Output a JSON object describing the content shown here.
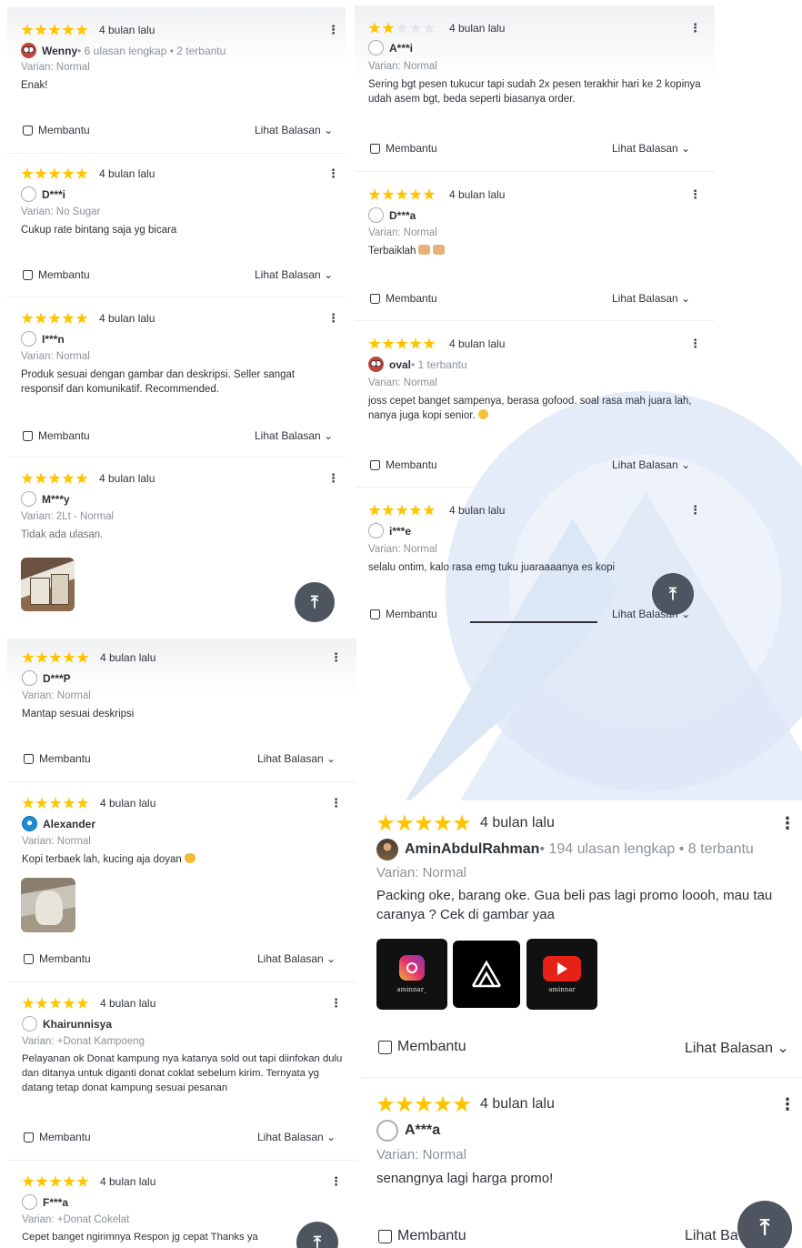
{
  "common": {
    "time_ago": "4 bulan lalu",
    "helpful_label": "Membantu",
    "reply_label": "Lihat Balasan",
    "kebab": "⋮",
    "scroll_top": "⤒",
    "chevron": "⌄",
    "star_color": "#ffc400",
    "star_empty_color": "#e4e6e9"
  },
  "panel_a": {
    "reviews": [
      {
        "rating": 5,
        "user": "Wenny",
        "meta": " • 6 ulasan lengkap • 2 terbantu",
        "variant": "Varian: Normal",
        "text": "Enak!"
      },
      {
        "rating": 5,
        "user": "D***i",
        "meta": "",
        "variant": "Varian: No Sugar",
        "text": "Cukup rate bintang saja yg bicara"
      },
      {
        "rating": 5,
        "user": "I***n",
        "meta": "",
        "variant": "Varian: Normal",
        "text": "Produk sesuai dengan gambar dan deskripsi. Seller sangat responsif dan komunikatif. Recommended."
      },
      {
        "rating": 5,
        "user": "M***y",
        "meta": "",
        "variant": "Varian: 2Lt - Normal",
        "text": "Tidak ada ulasan."
      }
    ]
  },
  "panel_b": {
    "reviews": [
      {
        "rating": 2,
        "user": "A***i",
        "meta": "",
        "variant": "Varian: Normal",
        "text": "Sering bgt pesen tukucur tapi sudah 2x pesen terakhir hari ke 2 kopinya udah asem bgt, beda seperti biasanya order."
      },
      {
        "rating": 5,
        "user": "D***a",
        "meta": "",
        "variant": "Varian: Normal",
        "text": "Terbaiklah"
      },
      {
        "rating": 5,
        "user": "oval",
        "meta": " • 1 terbantu",
        "variant": "Varian: Normal",
        "text": "joss cepet banget sampenya, berasa gofood. soal rasa mah juara lah, nanya juga kopi senior."
      },
      {
        "rating": 5,
        "user": "i***e",
        "meta": "",
        "variant": "Varian: Normal",
        "text": "selalu ontim, kalo rasa emg tuku juaraaaanya es kopi"
      }
    ]
  },
  "panel_c": {
    "reviews": [
      {
        "rating": 5,
        "user": "D***P",
        "meta": "",
        "variant": "Varian: Normal",
        "text": "Mantap sesuai deskripsi"
      },
      {
        "rating": 5,
        "user": "Alexander",
        "meta": "",
        "variant": "Varian: Normal",
        "text": "Kopi terbaek lah, kucing aja doyan"
      },
      {
        "rating": 5,
        "user": "Khairunnisya",
        "meta": "",
        "variant": "Varian: +Donat Kampoeng",
        "text": "Pelayanan ok Donat kampung nya katanya sold out tapi diinfokan dulu dan ditanya untuk diganti donat coklat sebelum kirim. Ternyata yg datang tetap donat kampung sesuai pesanan"
      },
      {
        "rating": 5,
        "user": "F***a",
        "meta": "",
        "variant": "Varian: +Donat Cokelat",
        "text": "Cepet banget ngirimnya Respon jg cepat Thanks ya"
      }
    ]
  },
  "panel_d": {
    "reviews": [
      {
        "rating": 5,
        "user": "AminAbdulRahman",
        "meta": " • 194 ulasan lengkap • 8 terbantu",
        "variant": "Varian: Normal",
        "text": "Packing oke, barang oke. Gua beli pas lagi promo loooh, mau tau caranya ? Cek di gambar yaa"
      },
      {
        "rating": 5,
        "user": "A***a",
        "meta": "",
        "variant": "Varian: Normal",
        "text": "senangnya lagi harga promo!"
      }
    ],
    "social_captions": [
      "aminnar_",
      "aminnar"
    ],
    "reply_partial": "Lihat Ba"
  }
}
